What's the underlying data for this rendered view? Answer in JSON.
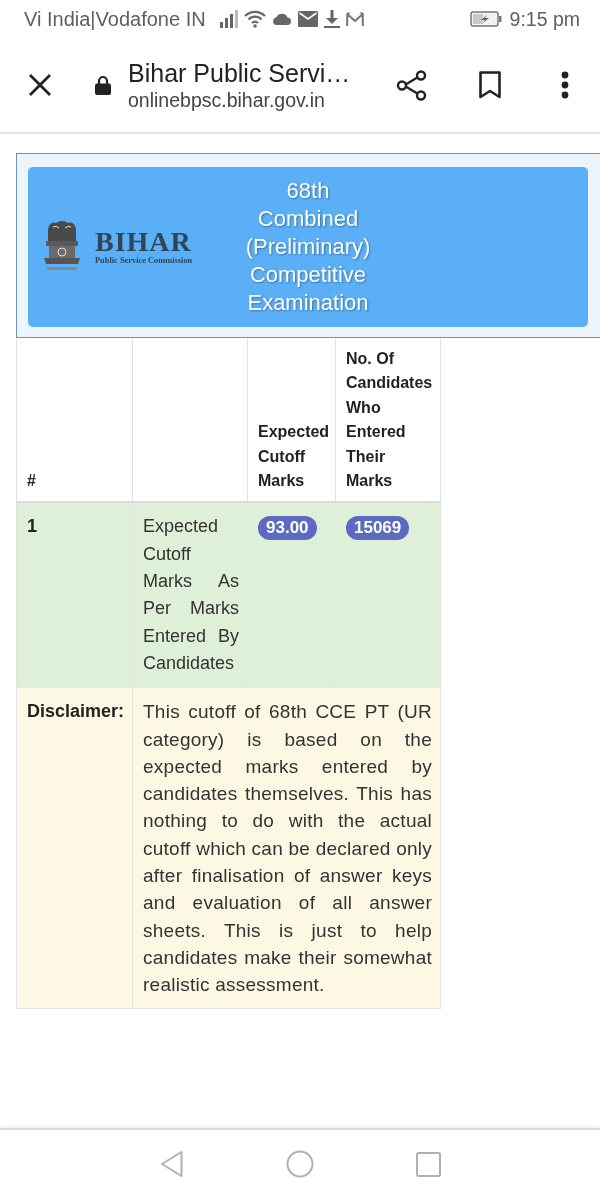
{
  "status_bar": {
    "carrier": "Vi India|Vodafone IN",
    "time": "9:15 pm"
  },
  "browser_toolbar": {
    "title": "Bihar Public Servi…",
    "url": "onlinebpsc.bihar.gov.in"
  },
  "header": {
    "logo": {
      "name": "BIHAR",
      "subtitle": "Public Service Commission"
    },
    "title": "68th Combined (Preliminary) Competitive Examination"
  },
  "table": {
    "columns": [
      {
        "label": "#"
      },
      {},
      {
        "label": "Expected Cutoff Marks"
      },
      {
        "label": "No. Of Candidates Who Entered Their Marks"
      }
    ],
    "rows": [
      {
        "number": "1",
        "description": "Expected Cutoff Marks As Per Marks Entered By Candidates",
        "expected_cutoff_marks": "93.00",
        "candidates_count": "15069"
      }
    ],
    "disclaimer": {
      "label": "Disclaimer:",
      "text": "This cutoff of 68th CCE PT (UR category) is based on the expected marks entered by candidates themselves. This has nothing to do with the actual cutoff which can be declared only after finalisation of answer keys and evaluation of all answer sheets. This is just to help candidates make their somewhat realistic assessment."
    }
  }
}
